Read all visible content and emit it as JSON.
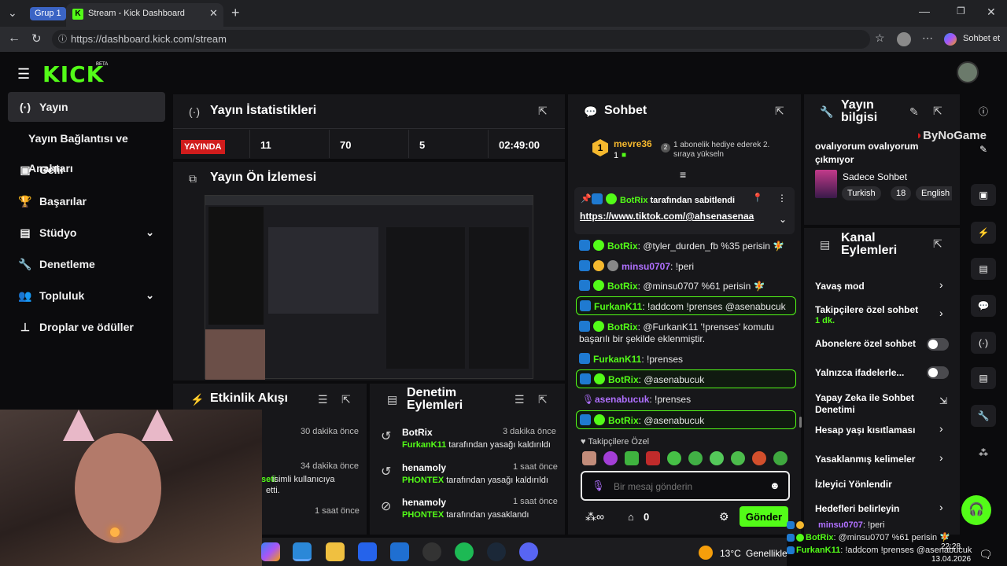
{
  "browser": {
    "group_label": "Grup 1",
    "tab_title": "Stream - Kick Dashboard",
    "url": "https://dashboard.kick.com/stream",
    "copilot_label": "Sohbet et"
  },
  "header": {
    "logo": "KICK",
    "logo_badge": "BETA"
  },
  "sidebar": {
    "items": [
      {
        "label": "Yayın",
        "icon": "broadcast-icon"
      },
      {
        "label": "Yayın Bağlantısı ve Anahtarı"
      },
      {
        "label": "Gelir",
        "icon": "wallet-icon"
      },
      {
        "label": "Başarılar",
        "icon": "trophy-icon"
      },
      {
        "label": "Stüdyo",
        "icon": "studio-icon"
      },
      {
        "label": "Denetleme",
        "icon": "wrench-icon"
      },
      {
        "label": "Topluluk",
        "icon": "community-icon"
      },
      {
        "label": "Droplar ve ödüller",
        "icon": "drops-icon"
      }
    ]
  },
  "stats": {
    "title": "Yayın İstatistikleri",
    "live_badge": "YAYINDA",
    "values": [
      "11",
      "70",
      "5",
      "02:49:00"
    ]
  },
  "preview": {
    "title": "Yayın Ön İzlemesi"
  },
  "activity": {
    "title": "Etkinlik Akışı",
    "rows": [
      {
        "time": "30 dakika önce",
        "text": ""
      },
      {
        "time": "34 dakika önce",
        "text_a": "seti",
        "text_b": " isimli kullanıcıya",
        "text_c": "etti."
      },
      {
        "time": "1 saat önce",
        "text": ""
      }
    ]
  },
  "moderation": {
    "title_l1": "Denetim",
    "title_l2": "Eylemleri",
    "rows": [
      {
        "user": "BotRix",
        "time": "3 dakika önce",
        "actor": "FurkanK11",
        "action": " tarafından yasağı kaldırıldı"
      },
      {
        "user": "henamoly",
        "time": "1 saat önce",
        "actor": "PHONTEX",
        "action": " tarafından yasağı kaldırıldı"
      },
      {
        "user": "henamoly",
        "time": "1 saat önce",
        "actor": "PHONTEX",
        "action": " tarafından yasaklandı"
      }
    ]
  },
  "chat": {
    "title": "Sohbet",
    "top_gifter": {
      "rank": "1",
      "name": "mevre36",
      "count": "1",
      "hint": "1 abonelik hediye ederek 2. sıraya yükseln"
    },
    "pinned": {
      "by": "BotRix",
      "label": " tarafından sabitlendi",
      "link": "https://www.tiktok.com/@ahsenasenaa"
    },
    "messages": [
      {
        "user": "BotRix",
        "text": ": @tyler_durden_fb %35 perisin 🧚"
      },
      {
        "user": "minsu0707",
        "text": ": !peri"
      },
      {
        "user": "BotRix",
        "text": ": @minsu0707 %61 perisin 🧚"
      },
      {
        "user": "FurkanK11",
        "text": ": !addcom !prenses @asenabucuk"
      },
      {
        "user": "BotRix",
        "text": ": @FurkanK11 '!prenses' komutu başarılı bir şekilde eklenmiştir."
      },
      {
        "user": "FurkanK11",
        "text": ": !prenses"
      },
      {
        "user": "BotRix",
        "text": ": @asenabucuk"
      },
      {
        "user": "asenabucuk",
        "text": ": !prenses"
      },
      {
        "user": "BotRix",
        "text": ": @asenabucuk"
      }
    ],
    "followers_label": "Takipçilere Özel",
    "input_placeholder": "Bir mesaj gönderin",
    "points": "0",
    "send_label": "Gönder"
  },
  "stream_info": {
    "title_l1": "Yayın",
    "title_l2": "bilgisi",
    "stream_title": "ovalıyorum ovalıyorum çıkmıyor",
    "category": "Sadece Sohbet",
    "tags": [
      "Turkish",
      "18",
      "English"
    ],
    "watermark": "ByNoGame"
  },
  "channel_actions": {
    "title_l1": "Kanal",
    "title_l2": "Eylemleri",
    "items": [
      {
        "label": "Yavaş mod"
      },
      {
        "label": "Takipçilere özel sohbet",
        "sub": "1 dk."
      },
      {
        "label": "Abonelere özel sohbet"
      },
      {
        "label": "Yalnızca ifadelerle..."
      },
      {
        "label": "Yapay Zeka ile Sohbet Denetimi"
      },
      {
        "label": "Hesap yaşı kısıtlaması"
      },
      {
        "label": "Yasaklanmış kelimeler"
      },
      {
        "label": "İzleyici Yönlendir"
      },
      {
        "label": "Hedefleri belirleyin"
      }
    ]
  },
  "overlay_chat": [
    {
      "user": "minsu0707",
      "text": ": !peri"
    },
    {
      "user": "BotRix",
      "text": ": @minsu0707 %61 perisin 🧚"
    },
    {
      "user": "FurkanK11",
      "text": ": !addcom !prenses @asenabucuk"
    }
  ],
  "taskbar": {
    "weather": "13°C",
    "weather_text": "Genellikle",
    "time": "22:28",
    "date": "13.04.2026"
  }
}
